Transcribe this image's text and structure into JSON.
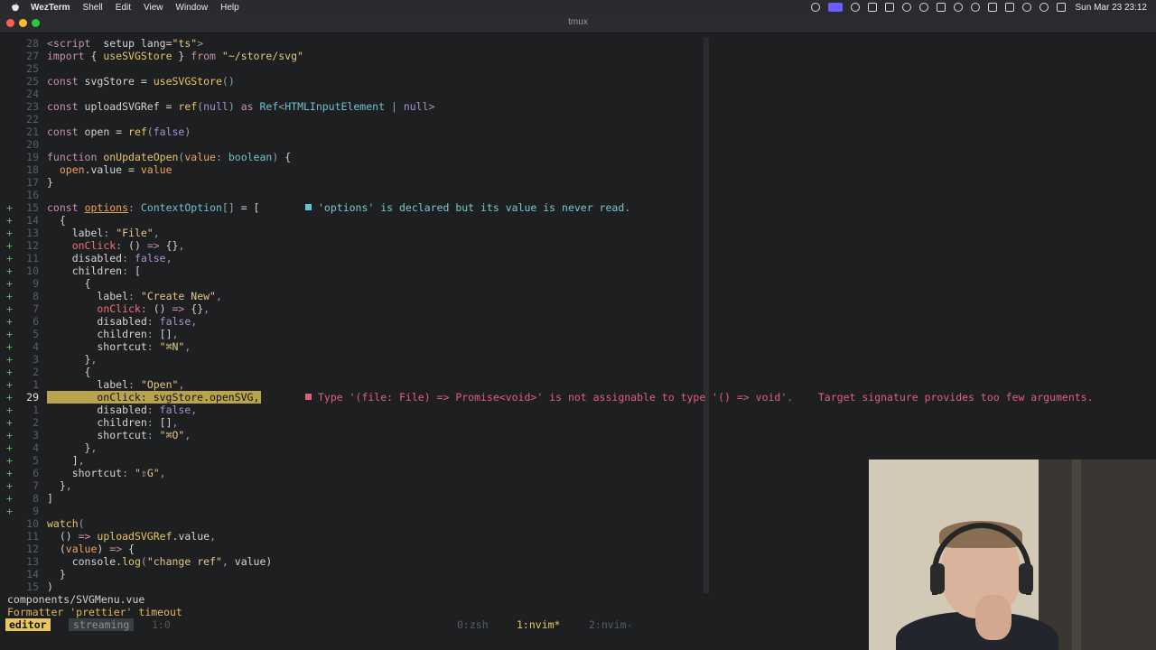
{
  "menubar": {
    "items": [
      "WezTerm",
      "Shell",
      "Edit",
      "View",
      "Window",
      "Help"
    ],
    "clock": "Sun Mar 23  23:12",
    "status_icons": [
      "record-icon",
      "screen-share-icon",
      "grid-icon",
      "clipboard-icon",
      "lock-icon",
      "color-icon",
      "cloud-icon",
      "display-icon",
      "location-icon",
      "play-icon",
      "battery-icon",
      "keyboard-icon",
      "wifi-icon",
      "search-icon",
      "control-center-icon"
    ]
  },
  "window": {
    "title": "tmux"
  },
  "editor": {
    "lines": [
      {
        "sign": "",
        "num": "28",
        "segs": [
          [
            "pun",
            "<"
          ],
          [
            "kw",
            "script"
          ],
          [
            "",
            "  setup lang="
          ],
          [
            "str",
            "\"ts\""
          ],
          [
            "pun",
            ">"
          ]
        ]
      },
      {
        "sign": "",
        "num": "27",
        "segs": [
          [
            "kw",
            "import"
          ],
          [
            "",
            " { "
          ],
          [
            "fn",
            "useSVGStore"
          ],
          [
            "",
            " } "
          ],
          [
            "kw",
            "from"
          ],
          [
            "",
            " "
          ],
          [
            "str",
            "\"~/store/svg\""
          ]
        ]
      },
      {
        "sign": "",
        "num": "25",
        "segs": []
      },
      {
        "sign": "",
        "num": "25",
        "segs": [
          [
            "kw",
            "const"
          ],
          [
            "",
            " svgStore = "
          ],
          [
            "fn",
            "useSVGStore"
          ],
          [
            "pun",
            "()"
          ]
        ]
      },
      {
        "sign": "",
        "num": "24",
        "segs": []
      },
      {
        "sign": "",
        "num": "23",
        "segs": [
          [
            "kw",
            "const"
          ],
          [
            "",
            " uploadSVGRef = "
          ],
          [
            "fn",
            "ref"
          ],
          [
            "pun",
            "("
          ],
          [
            "num",
            "null"
          ],
          [
            "pun",
            ")"
          ],
          [
            "",
            " "
          ],
          [
            "kw",
            "as"
          ],
          [
            "",
            " "
          ],
          [
            "typ",
            "Ref"
          ],
          [
            "pun",
            "<"
          ],
          [
            "typ",
            "HTMLInputElement"
          ],
          [
            "",
            " "
          ],
          [
            "pun",
            "|"
          ],
          [
            "",
            " "
          ],
          [
            "num",
            "null"
          ],
          [
            "pun",
            ">"
          ]
        ]
      },
      {
        "sign": "",
        "num": "22",
        "segs": []
      },
      {
        "sign": "",
        "num": "21",
        "segs": [
          [
            "kw",
            "const"
          ],
          [
            "",
            " open = "
          ],
          [
            "fn",
            "ref"
          ],
          [
            "pun",
            "("
          ],
          [
            "num",
            "false"
          ],
          [
            "pun",
            ")"
          ]
        ]
      },
      {
        "sign": "",
        "num": "20",
        "segs": []
      },
      {
        "sign": "",
        "num": "19",
        "segs": [
          [
            "kw",
            "function"
          ],
          [
            "",
            " "
          ],
          [
            "fn",
            "onUpdateOpen"
          ],
          [
            "pun",
            "("
          ],
          [
            "prop",
            "value"
          ],
          [
            "pun",
            ":"
          ],
          [
            "",
            " "
          ],
          [
            "typ",
            "boolean"
          ],
          [
            "pun",
            ")"
          ],
          [
            "",
            " {"
          ]
        ]
      },
      {
        "sign": "",
        "num": "18",
        "segs": [
          [
            "",
            "  "
          ],
          [
            "prop",
            "open"
          ],
          [
            "",
            ".value = "
          ],
          [
            "prop",
            "value"
          ]
        ]
      },
      {
        "sign": "",
        "num": "17",
        "segs": [
          [
            "",
            "}"
          ]
        ]
      },
      {
        "sign": "",
        "num": "16",
        "segs": []
      },
      {
        "sign": "+",
        "num": "15",
        "segs": [
          [
            "kw",
            "const"
          ],
          [
            "",
            " "
          ],
          [
            "prop und",
            "options"
          ],
          [
            "pun",
            ":"
          ],
          [
            "",
            " "
          ],
          [
            "typ",
            "ContextOption"
          ],
          [
            "pun",
            "[]"
          ],
          [
            "",
            " = ["
          ]
        ],
        "diag": {
          "type": "warn",
          "text": "'options' is declared but its value is never read."
        }
      },
      {
        "sign": "+",
        "num": "14",
        "segs": [
          [
            "",
            "  {"
          ]
        ]
      },
      {
        "sign": "+",
        "num": "13",
        "segs": [
          [
            "",
            "    label"
          ],
          [
            "pun",
            ":"
          ],
          [
            "",
            " "
          ],
          [
            "str",
            "\"File\""
          ],
          [
            "pun",
            ","
          ]
        ]
      },
      {
        "sign": "+",
        "num": "12",
        "segs": [
          [
            "",
            "    "
          ],
          [
            "prop2",
            "onClick"
          ],
          [
            "pun",
            ":"
          ],
          [
            "",
            " () "
          ],
          [
            "kw",
            "=>"
          ],
          [
            "",
            " {}"
          ],
          [
            "pun",
            ","
          ]
        ]
      },
      {
        "sign": "+",
        "num": "11",
        "segs": [
          [
            "",
            "    disabled"
          ],
          [
            "pun",
            ":"
          ],
          [
            "",
            " "
          ],
          [
            "num",
            "false"
          ],
          [
            "pun",
            ","
          ]
        ]
      },
      {
        "sign": "+",
        "num": "10",
        "segs": [
          [
            "",
            "    children"
          ],
          [
            "pun",
            ":"
          ],
          [
            "",
            " ["
          ]
        ]
      },
      {
        "sign": "+",
        "num": "9",
        "segs": [
          [
            "",
            "      {"
          ]
        ]
      },
      {
        "sign": "+",
        "num": "8",
        "segs": [
          [
            "",
            "        label"
          ],
          [
            "pun",
            ":"
          ],
          [
            "",
            " "
          ],
          [
            "str",
            "\"Create New\""
          ],
          [
            "pun",
            ","
          ]
        ]
      },
      {
        "sign": "+",
        "num": "7",
        "segs": [
          [
            "",
            "        "
          ],
          [
            "prop2",
            "onClick"
          ],
          [
            "pun",
            ":"
          ],
          [
            "",
            " () "
          ],
          [
            "kw",
            "=>"
          ],
          [
            "",
            " {}"
          ],
          [
            "pun",
            ","
          ]
        ]
      },
      {
        "sign": "+",
        "num": "6",
        "segs": [
          [
            "",
            "        disabled"
          ],
          [
            "pun",
            ":"
          ],
          [
            "",
            " "
          ],
          [
            "num",
            "false"
          ],
          [
            "pun",
            ","
          ]
        ]
      },
      {
        "sign": "+",
        "num": "5",
        "segs": [
          [
            "",
            "        children"
          ],
          [
            "pun",
            ":"
          ],
          [
            "",
            " []"
          ],
          [
            "pun",
            ","
          ]
        ]
      },
      {
        "sign": "+",
        "num": "4",
        "segs": [
          [
            "",
            "        shortcut"
          ],
          [
            "pun",
            ":"
          ],
          [
            "",
            " "
          ],
          [
            "str",
            "\"⌘N\""
          ],
          [
            "pun",
            ","
          ]
        ]
      },
      {
        "sign": "+",
        "num": "3",
        "segs": [
          [
            "",
            "      }"
          ],
          [
            "pun",
            ","
          ]
        ]
      },
      {
        "sign": "+",
        "num": "2",
        "segs": [
          [
            "",
            "      {"
          ]
        ]
      },
      {
        "sign": "+",
        "num": "1",
        "segs": [
          [
            "",
            "        label"
          ],
          [
            "pun",
            ":"
          ],
          [
            "",
            " "
          ],
          [
            "str",
            "\"Open\""
          ],
          [
            "pun",
            ","
          ]
        ]
      },
      {
        "sign": "+",
        "num": "29",
        "current": true,
        "segs": [
          [
            "",
            "        onClick: svgStore.openSVG,"
          ]
        ],
        "diag": {
          "type": "err",
          "text": "Type '(file: File) => Promise<void>' is not assignable to type '() => void'.    Target signature provides too few arguments."
        }
      },
      {
        "sign": "+",
        "num": "1",
        "segs": [
          [
            "",
            "        disabled"
          ],
          [
            "pun",
            ":"
          ],
          [
            "",
            " "
          ],
          [
            "num",
            "false"
          ],
          [
            "pun",
            ","
          ]
        ]
      },
      {
        "sign": "+",
        "num": "2",
        "segs": [
          [
            "",
            "        children"
          ],
          [
            "pun",
            ":"
          ],
          [
            "",
            " []"
          ],
          [
            "pun",
            ","
          ]
        ]
      },
      {
        "sign": "+",
        "num": "3",
        "segs": [
          [
            "",
            "        shortcut"
          ],
          [
            "pun",
            ":"
          ],
          [
            "",
            " "
          ],
          [
            "str",
            "\"⌘O\""
          ],
          [
            "pun",
            ","
          ]
        ]
      },
      {
        "sign": "+",
        "num": "4",
        "segs": [
          [
            "",
            "      }"
          ],
          [
            "pun",
            ","
          ]
        ]
      },
      {
        "sign": "+",
        "num": "5",
        "segs": [
          [
            "",
            "    ]"
          ],
          [
            "pun",
            ","
          ]
        ]
      },
      {
        "sign": "+",
        "num": "6",
        "segs": [
          [
            "",
            "    shortcut"
          ],
          [
            "pun",
            ":"
          ],
          [
            "",
            " "
          ],
          [
            "str",
            "\"⇧G\""
          ],
          [
            "pun",
            ","
          ]
        ]
      },
      {
        "sign": "+",
        "num": "7",
        "segs": [
          [
            "",
            "  }"
          ],
          [
            "pun",
            ","
          ]
        ]
      },
      {
        "sign": "+",
        "num": "8",
        "segs": [
          [
            "",
            "]"
          ]
        ]
      },
      {
        "sign": "+",
        "num": "9",
        "segs": []
      },
      {
        "sign": "",
        "num": "10",
        "segs": [
          [
            "fn",
            "watch"
          ],
          [
            "pun",
            "("
          ]
        ]
      },
      {
        "sign": "",
        "num": "11",
        "segs": [
          [
            "",
            "  () "
          ],
          [
            "kw",
            "=>"
          ],
          [
            "",
            " "
          ],
          [
            "fn",
            "uploadSVGRef"
          ],
          [
            "",
            ".value"
          ],
          [
            "pun",
            ","
          ]
        ]
      },
      {
        "sign": "",
        "num": "12",
        "segs": [
          [
            "",
            "  ("
          ],
          [
            "prop",
            "value"
          ],
          [
            "",
            ") "
          ],
          [
            "kw",
            "=>"
          ],
          [
            "",
            " {"
          ]
        ]
      },
      {
        "sign": "",
        "num": "13",
        "segs": [
          [
            "",
            "    console."
          ],
          [
            "fn",
            "log"
          ],
          [
            "pun",
            "("
          ],
          [
            "str",
            "\"change ref\""
          ],
          [
            "pun",
            ","
          ],
          [
            "",
            " value)"
          ]
        ]
      },
      {
        "sign": "",
        "num": "14",
        "segs": [
          [
            "",
            "  }"
          ]
        ]
      },
      {
        "sign": "",
        "num": "15",
        "segs": [
          [
            "",
            ")"
          ]
        ]
      }
    ]
  },
  "statusline": {
    "filename": "components/SVGMenu.vue",
    "message": "Formatter 'prettier' timeout"
  },
  "tmux": {
    "session": "editor",
    "session2": "streaming",
    "session3": "1:0",
    "windows": [
      "0:zsh",
      "1:nvim*",
      "2:nvim-"
    ]
  },
  "colors": {
    "accent": "#e8c85c",
    "error": "#e0607a",
    "warning": "#5bc8d4",
    "added": "#5faf5f"
  }
}
